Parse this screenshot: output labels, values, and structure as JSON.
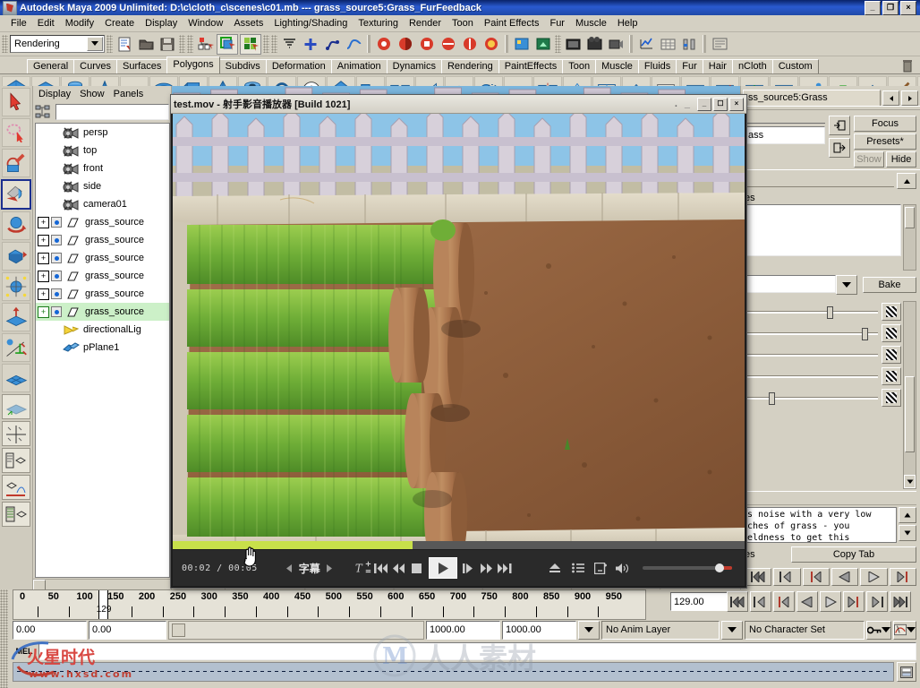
{
  "window": {
    "title": "Autodesk Maya 2009 Unlimited: D:\\c\\cloth_c\\scenes\\c01.mb   ---   grass_source5:Grass_FurFeedback",
    "minimize": "_",
    "restore": "❐",
    "close": "×"
  },
  "menubar": {
    "items": [
      "File",
      "Edit",
      "Modify",
      "Create",
      "Display",
      "Window",
      "Assets",
      "Lighting/Shading",
      "Texturing",
      "Render",
      "Toon",
      "Paint Effects",
      "Fur",
      "Muscle",
      "Help"
    ]
  },
  "toolline": {
    "menuset": "Rendering",
    "icons": [
      "open-scene-icon",
      "open-folder-icon",
      "save-scene-icon",
      "undo-icon",
      "select-by-hierarchy-icon",
      "select-by-object-icon",
      "select-by-component-icon",
      "snap-to-grid-icon",
      "plus-icon",
      "construction-history-icon",
      "curve-icon",
      "render-icon",
      "render-sequence-icon",
      "ipr-icon",
      "render-settings-icon",
      "hypershade-icon",
      "render-view-icon",
      "playblast-icon",
      "animation-icon",
      "light-icon",
      "outliner-icon",
      "graph-editor-icon"
    ]
  },
  "shelf": {
    "tabs": [
      "General",
      "Curves",
      "Surfaces",
      "Polygons",
      "Subdivs",
      "Deformation",
      "Animation",
      "Dynamics",
      "Rendering",
      "PaintEffects",
      "Toon",
      "Muscle",
      "Fluids",
      "Fur",
      "Hair",
      "nCloth",
      "Custom"
    ],
    "active_tab": "Polygons",
    "trash_icon": "trash-icon",
    "icons": [
      "poly-sphere-icon",
      "poly-cube-icon",
      "poly-cylinder-icon",
      "poly-cone-icon",
      "poly-plane-icon",
      "poly-torus-icon",
      "poly-prism-icon",
      "poly-pyramid-icon",
      "poly-pipe-icon",
      "poly-helix-icon",
      "poly-soccer-icon",
      "poly-platonic-icon",
      "poly-combine-icon",
      "poly-separate-icon",
      "poly-extrude-icon",
      "poly-bridge-icon",
      "poly-booleans-icon",
      "poly-smooth-icon",
      "poly-mirror-icon",
      "poly-triangulate-icon",
      "poly-quadrangulate-icon",
      "poly-reduce-icon",
      "poly-cleanup-icon",
      "poly-split-icon",
      "poly-cut-face-icon",
      "poly-insert-edge-icon",
      "poly-offset-edge-icon",
      "poly-append-icon",
      "poly-bevel-icon",
      "poly-wedge-icon",
      "poly-paint-icon",
      "poly-sculpt-icon",
      "poly-texture-icon",
      "poly-uv-icon",
      "poly-normals-icon",
      "poly-checker-icon",
      "poly-transfer-icon"
    ]
  },
  "toolbox": {
    "items": [
      {
        "name": "select-tool",
        "icon": "arrow-cursor-icon",
        "active": false
      },
      {
        "name": "lasso-tool",
        "icon": "lasso-icon",
        "active": false
      },
      {
        "name": "paint-selection-tool",
        "icon": "paint-brush-icon",
        "active": false
      },
      {
        "name": "move-tool",
        "icon": "move-arrow-icon",
        "active": true
      },
      {
        "name": "rotate-tool",
        "icon": "rotate-sphere-icon",
        "active": false
      },
      {
        "name": "scale-tool",
        "icon": "scale-cube-icon",
        "active": false
      },
      {
        "name": "universal-manipulator",
        "icon": "universal-manip-icon",
        "active": false
      },
      {
        "name": "soft-modification-tool",
        "icon": "soft-mod-icon",
        "active": false
      },
      {
        "name": "show-manipulator-tool",
        "icon": "show-manip-icon",
        "active": false
      },
      {
        "name": "last-tool-used",
        "icon": "grid-plane-icon",
        "active": false
      }
    ],
    "layouts": [
      "single-perspective-layout",
      "four-view-layout",
      "outliner-persp-layout",
      "persp-graph-layout",
      "hypershade-persp-layout"
    ]
  },
  "outliner": {
    "menus": [
      "Display",
      "Show",
      "Panels"
    ],
    "filter_icon": "hierarchy-filter-icon",
    "search_value": "",
    "rows": [
      {
        "label": "persp",
        "icon": "camera-icon",
        "expand": "none",
        "vis": false,
        "selected": false
      },
      {
        "label": "top",
        "icon": "camera-icon",
        "expand": "none",
        "vis": false,
        "selected": false
      },
      {
        "label": "front",
        "icon": "camera-icon",
        "expand": "none",
        "vis": false,
        "selected": false
      },
      {
        "label": "side",
        "icon": "camera-icon",
        "expand": "none",
        "vis": false,
        "selected": false
      },
      {
        "label": "camera01",
        "icon": "camera-icon",
        "expand": "none",
        "vis": false,
        "selected": false
      },
      {
        "label": "grass_source",
        "icon": "mesh-icon",
        "expand": "plus",
        "vis": true,
        "selected": false
      },
      {
        "label": "grass_source",
        "icon": "mesh-icon",
        "expand": "plus",
        "vis": true,
        "selected": false
      },
      {
        "label": "grass_source",
        "icon": "mesh-icon",
        "expand": "plus",
        "vis": true,
        "selected": false
      },
      {
        "label": "grass_source",
        "icon": "mesh-icon",
        "expand": "plus",
        "vis": true,
        "selected": false
      },
      {
        "label": "grass_source",
        "icon": "mesh-icon",
        "expand": "plus",
        "vis": true,
        "selected": false
      },
      {
        "label": "grass_source",
        "icon": "mesh-icon",
        "expand": "plus-green",
        "vis": true,
        "selected": true
      },
      {
        "label": "directionalLig",
        "icon": "directional-light-icon",
        "expand": "none",
        "vis": false,
        "selected": false
      },
      {
        "label": "pPlane1",
        "icon": "plane-mesh-icon",
        "expand": "none",
        "vis": false,
        "selected": false
      }
    ]
  },
  "attribute_editor": {
    "tab_label": "ss_source5:Grass",
    "prev_icon": "left-arrow-icon",
    "next_icon": "right-arrow-icon",
    "name_value": "ass",
    "focus": "Focus",
    "presets": "Presets*",
    "show": "Show",
    "hide": "Hide",
    "section_label": "es",
    "bake": "Bake",
    "copy_tab": "Copy Tab",
    "tabs_label": "es",
    "notes_text": "s noise with a very low\nches of grass - you\neldness to get this",
    "collapse_icon": "collapse-arrow-icon",
    "down_icon": "expand-arrow-icon",
    "checker_icon": "map-checker-icon"
  },
  "player": {
    "title": "test.mov - 射手影音播放器 [Build 1021]",
    "titlebar_buttons": [
      "minimize-button",
      "maximize-button",
      "close-button"
    ],
    "btn_min": "_",
    "btn_max": "☐",
    "btn_close": "×",
    "time": "00:02 / 00:05",
    "subtitle_label": "字幕",
    "seek_percent": 42,
    "volume_percent": 90,
    "controls": [
      {
        "name": "subtitle-prev-icon",
        "glyph": "◂"
      },
      {
        "name": "subtitle-next-icon",
        "glyph": "▸"
      },
      {
        "name": "subtitle-font-size-icon",
        "glyph": "T"
      },
      {
        "name": "prev-chapter-icon",
        "glyph": "⏮"
      },
      {
        "name": "rewind-icon",
        "glyph": "⏪"
      },
      {
        "name": "stop-icon",
        "glyph": "■"
      },
      {
        "name": "play-icon",
        "glyph": "▶"
      },
      {
        "name": "step-frame-icon",
        "glyph": "⏭"
      },
      {
        "name": "fast-forward-icon",
        "glyph": "⏩"
      },
      {
        "name": "next-chapter-icon",
        "glyph": "⏭"
      },
      {
        "name": "eject-icon",
        "glyph": "⏏"
      },
      {
        "name": "playlist-icon",
        "glyph": "≡"
      },
      {
        "name": "open-file-icon",
        "glyph": "❐"
      },
      {
        "name": "volume-icon",
        "glyph": "🔊"
      }
    ]
  },
  "timeline": {
    "labels": [
      "0",
      "50",
      "100",
      "150",
      "200",
      "250",
      "300",
      "350",
      "400",
      "450",
      "500",
      "550",
      "600",
      "650",
      "700",
      "750",
      "800",
      "850",
      "900",
      "950"
    ],
    "current_frame_label": "129",
    "current_frame_field": "129.00",
    "range_start": "0.00",
    "range_end": "0.00",
    "anim_start": "1000.00",
    "anim_end": "1000.00",
    "anim_layer": "No Anim Layer",
    "character_set": "No Character Set",
    "playback_buttons": [
      "go-to-start-icon",
      "step-back-keyframe-icon",
      "step-back-frame-icon",
      "play-backwards-icon",
      "play-forwards-icon",
      "step-forward-frame-icon",
      "step-forward-keyframe-icon",
      "go-to-end-icon"
    ],
    "key-icon": "key-icon",
    "anim-pref-icon": "animation-preferences-icon"
  },
  "statusline": {
    "mel_label": "MEL",
    "command_value": "",
    "script_editor_icon": "script-editor-icon"
  },
  "watermarks": {
    "hxsd_url": "www.hxsd.com",
    "hxsd_name": "火星时代",
    "rr_name": "人人素材"
  }
}
